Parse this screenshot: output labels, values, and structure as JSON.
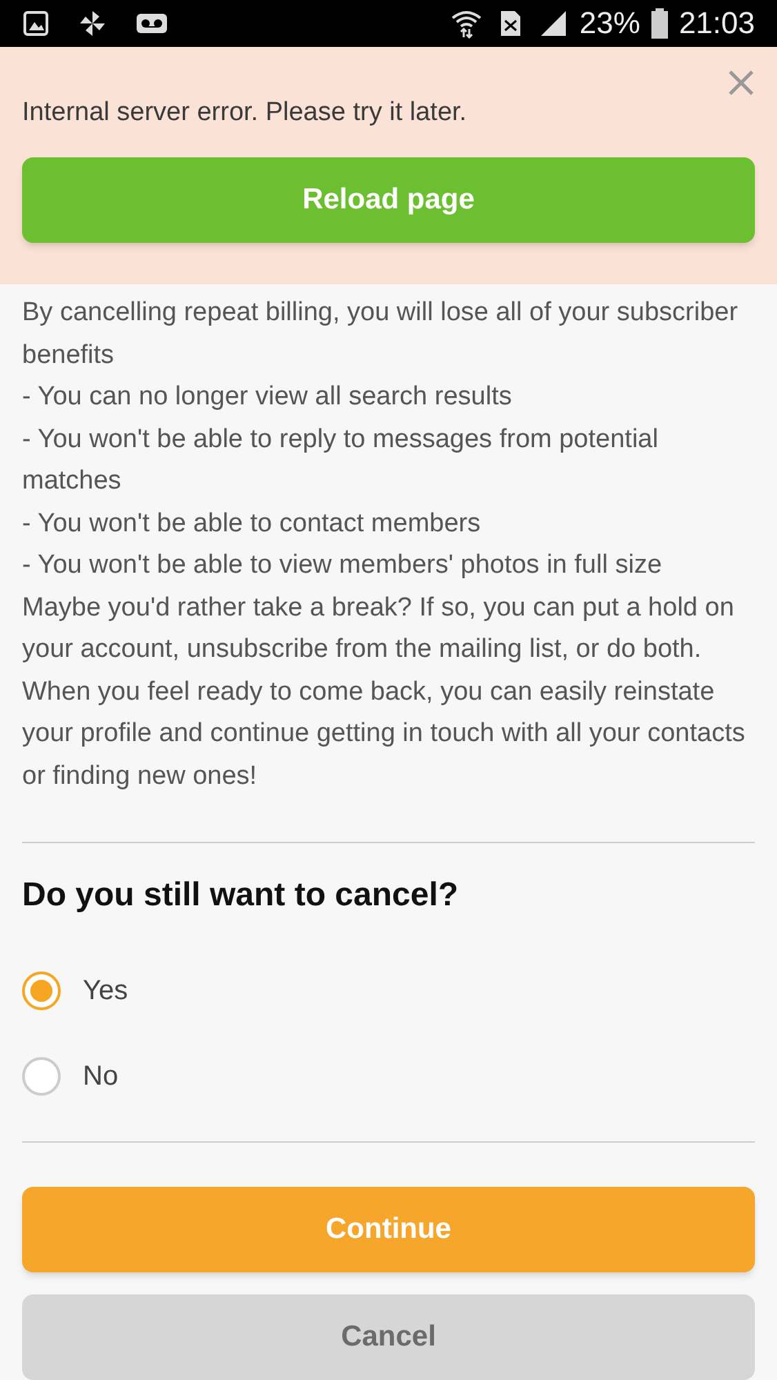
{
  "status_bar": {
    "battery_text": "23%",
    "time": "21:03"
  },
  "error_banner": {
    "message": "Internal server error. Please try it later.",
    "button": "Reload page"
  },
  "body": {
    "paragraphs": [
      "By cancelling repeat billing, you will lose all of your subscriber benefits",
      "- You can no longer view all search results",
      "- You won't be able to reply to messages from potential matches",
      "- You won't be able to contact members",
      "- You won't be able to view members' photos in full size",
      "Maybe you'd rather take a break? If so, you can put a hold on your account, unsubscribe from the mailing list, or do both. When you feel ready to come back, you can easily reinstate your profile and continue getting in touch with all your contacts or finding new ones!"
    ]
  },
  "question": {
    "title": "Do you still want to cancel?",
    "options": [
      {
        "label": "Yes",
        "selected": true
      },
      {
        "label": "No",
        "selected": false
      }
    ]
  },
  "buttons": [
    {
      "label": "Continue",
      "kind": "primary"
    },
    {
      "label": "Cancel",
      "kind": "secondary"
    }
  ]
}
